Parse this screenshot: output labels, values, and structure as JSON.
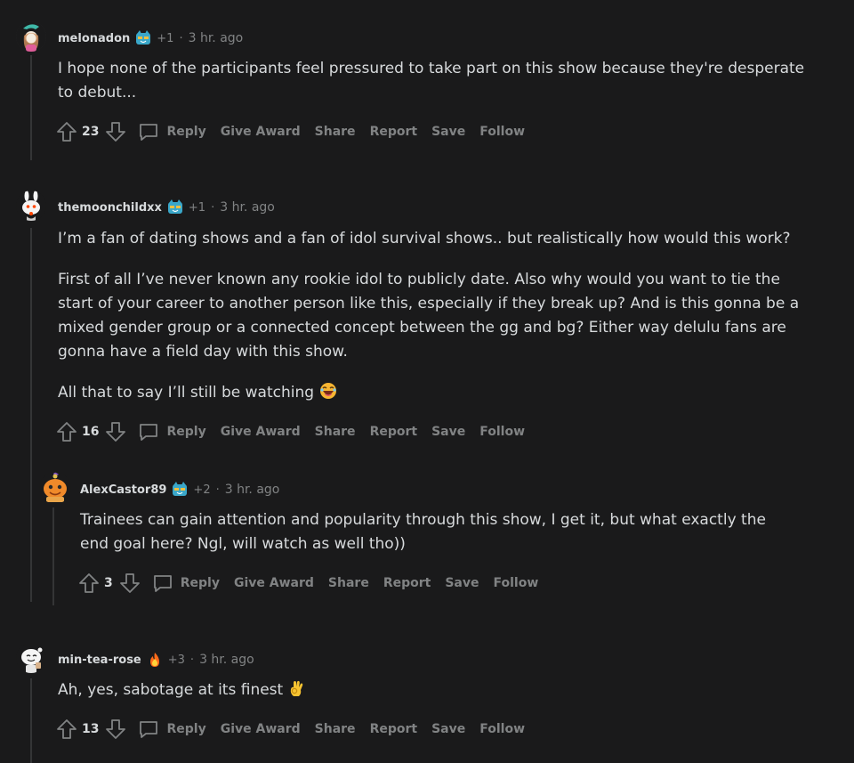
{
  "comments": [
    {
      "username": "melonadon",
      "karma": "+1",
      "dot": "·",
      "time": "3 hr. ago",
      "paragraphs": [
        "I hope none of the participants feel pressured to take part on this show because they're desperate to debut..."
      ],
      "score": "23",
      "actions": {
        "reply": "Reply",
        "award": "Give Award",
        "share": "Share",
        "report": "Report",
        "save": "Save",
        "follow": "Follow"
      }
    },
    {
      "username": "themoonchildxx",
      "karma": "+1",
      "dot": "·",
      "time": "3 hr. ago",
      "paragraphs": [
        "I’m a fan of dating shows and a fan of idol survival shows.. but realistically how would this work?",
        "First of all I’ve never known any rookie idol to publicly date. Also why would you want to tie the start of your career to another person like this, especially if they break up? And is this gonna be a mixed gender group or a connected concept between the gg and bg? Either way delulu fans are gonna have a field day with this show.",
        "All that to say I’ll still be watching"
      ],
      "score": "16",
      "actions": {
        "reply": "Reply",
        "award": "Give Award",
        "share": "Share",
        "report": "Report",
        "save": "Save",
        "follow": "Follow"
      }
    },
    {
      "username": "AlexCastor89",
      "karma": "+2",
      "dot": "·",
      "time": "3 hr. ago",
      "paragraphs": [
        "Trainees can gain attention and popularity through this show, I get it, but what exactly the end goal here? Ngl, will watch as well tho))"
      ],
      "score": "3",
      "actions": {
        "reply": "Reply",
        "award": "Give Award",
        "share": "Share",
        "report": "Report",
        "save": "Save",
        "follow": "Follow"
      }
    },
    {
      "username": "min-tea-rose",
      "karma": "+3",
      "dot": "·",
      "time": "3 hr. ago",
      "paragraphs": [
        "Ah, yes, sabotage at its finest"
      ],
      "score": "13",
      "actions": {
        "reply": "Reply",
        "award": "Give Award",
        "share": "Share",
        "report": "Report",
        "save": "Save",
        "follow": "Follow"
      }
    }
  ],
  "colors": {
    "background": "#1a1a1b",
    "text": "#d7dadc",
    "muted": "#818384",
    "thread_line": "#343536"
  },
  "icons": [
    "upvote-icon",
    "downvote-icon",
    "reply-bubble-icon",
    "flair-cat-icon",
    "flair-flame-icon",
    "laughing-emoji",
    "ok-hand-emoji"
  ]
}
